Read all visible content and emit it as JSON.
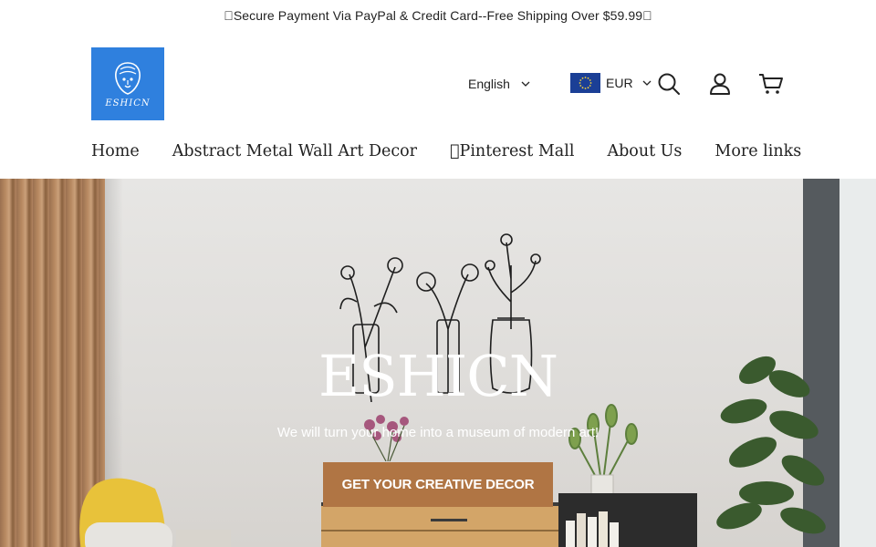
{
  "announcement": "\u0000Secure Payment Via PayPal & Credit Card--Free Shipping Over $59.99\u0000",
  "header": {
    "logo_text": "ESHICN",
    "language": "English",
    "currency": "EUR",
    "icons": [
      "search-icon",
      "account-icon",
      "cart-icon",
      "chevron-down-icon",
      "eu-flag-icon"
    ]
  },
  "nav": {
    "items": [
      {
        "label": "Home"
      },
      {
        "label": "Abstract Metal Wall Art Decor"
      },
      {
        "label": "\u0000Pinterest Mall"
      },
      {
        "label": "About Us"
      },
      {
        "label": "More links"
      }
    ]
  },
  "hero": {
    "title": "ESHICN",
    "subtitle": "We will turn your home into a museum of modern art!",
    "cta_label": "GET YOUR CREATIVE DECOR"
  },
  "colors": {
    "logo_bg": "#2f80de",
    "cta_bg": "#b07544",
    "flag_bg": "#1b3f96",
    "flag_stars": "#f5d23a"
  }
}
